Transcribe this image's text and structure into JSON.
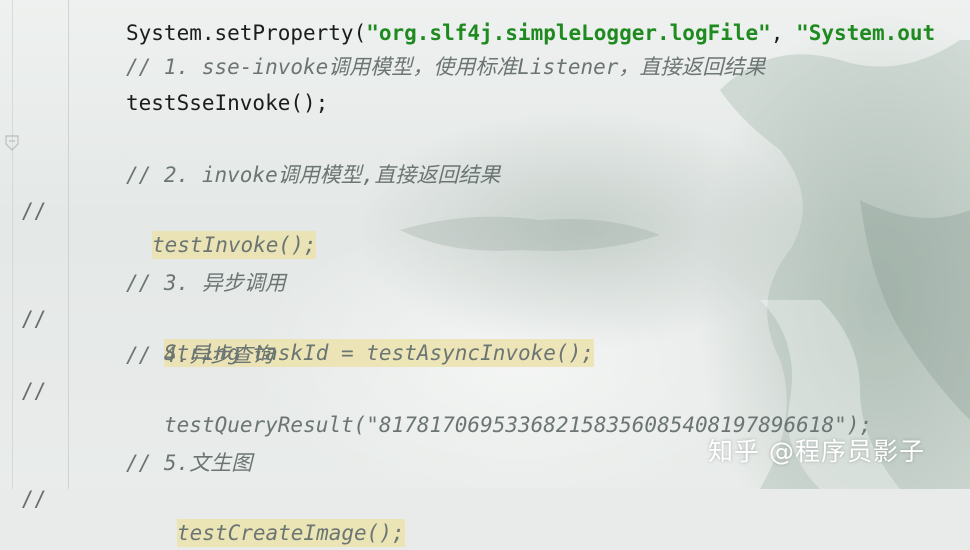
{
  "editor": {
    "lines": [
      {
        "gutter": "",
        "code": "System.setProperty(\"org.slf4j.simpleLogger.logFile\", \"System.out",
        "kind": "partial"
      },
      {
        "gutter": "",
        "code": "// 1. sse-invoke调用模型，使用标准Listener，直接返回结果",
        "kind": "comment"
      },
      {
        "gutter": "",
        "code": "testSseInvoke();",
        "kind": "plain"
      },
      {
        "gutter": "",
        "code": "// 2. invoke调用模型,直接返回结果",
        "kind": "comment"
      },
      {
        "gutter": "//",
        "code": "testInvoke();",
        "kind": "highlighted"
      },
      {
        "gutter": "",
        "code": "// 3. 异步调用",
        "kind": "comment"
      },
      {
        "gutter": "//",
        "code": "String taskId = testAsyncInvoke();",
        "kind": "highlighted"
      },
      {
        "gutter": "",
        "code": "// 4.异步查询",
        "kind": "comment"
      },
      {
        "gutter": "//",
        "code": "testQueryResult(\"8178170695336821583560854081978966 18\");",
        "kind": "commented"
      },
      {
        "gutter": "",
        "code": "// 5.文生图",
        "kind": "comment"
      },
      {
        "gutter": "//",
        "code": "testCreateImage();",
        "kind": "highlighted"
      }
    ],
    "partial_prefix": "System.setProperty(",
    "partial_string1": "\"org.slf4j.simpleLogger.logFile\"",
    "partial_sep": ", ",
    "partial_string2": "\"System.out",
    "line_comment_1": "// 1. sse-invoke调用模型，使用标准Listener，直接返回结果",
    "line_sse": "testSseInvoke();",
    "line_comment_2": "// 2. invoke调用模型,直接返回结果",
    "gutter_slashes": "//",
    "line_invoke": "testInvoke();",
    "line_comment_3": "// 3. 异步调用",
    "line_async": "String taskId = testAsyncInvoke();",
    "line_comment_4": "// 4.异步查询",
    "line_query": "testQueryResult(\"817817069533682158356085408197896618\");",
    "line_comment_5": "// 5.文生图",
    "line_create": "testCreateImage();"
  },
  "watermark": "知乎 @程序员影子",
  "colors": {
    "comment": "#6b7574",
    "string": "#1f8a1f",
    "highlight": "#ece2aa",
    "plain": "#1c1c1c"
  }
}
